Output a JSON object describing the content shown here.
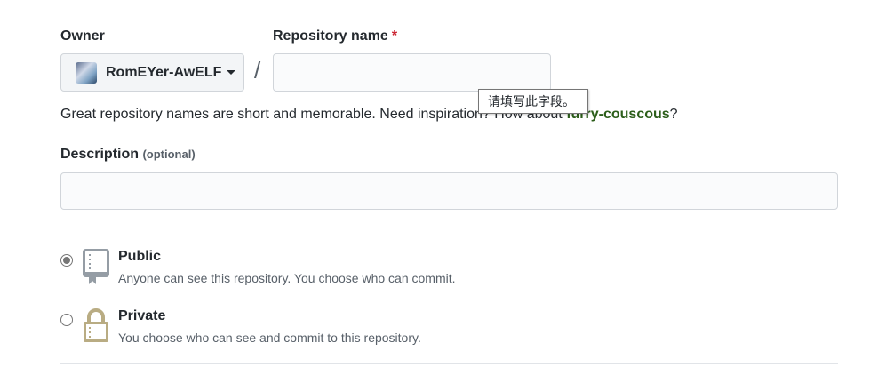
{
  "owner": {
    "label": "Owner",
    "value": "RomEYer-AwELF"
  },
  "repo_name": {
    "label": "Repository name",
    "required_mark": "*",
    "value": "",
    "placeholder": ""
  },
  "separator": "/",
  "validation_tooltip": "请填写此字段。",
  "hint": {
    "text": "Great repository names are short and memorable. Need inspiration? How about ",
    "suggestion": "furry-couscous",
    "suffix": "?"
  },
  "description": {
    "label": "Description",
    "optional": "(optional)",
    "value": ""
  },
  "visibility": [
    {
      "title": "Public",
      "desc": "Anyone can see this repository. You choose who can commit.",
      "selected": true,
      "icon": "repo-book-icon"
    },
    {
      "title": "Private",
      "desc": "You choose who can see and commit to this repository.",
      "selected": false,
      "icon": "lock-icon"
    }
  ],
  "colors": {
    "suggestion": "#2c5e1a",
    "required": "#cb2431",
    "lock": "#b9ac83",
    "book": "#959da5"
  }
}
